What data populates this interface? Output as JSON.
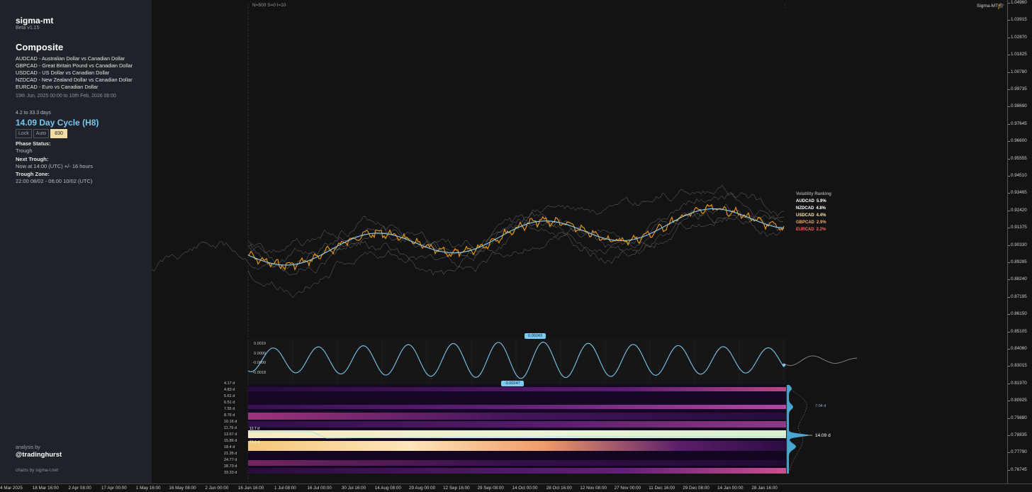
{
  "sidebar": {
    "brand": "sigma-mt",
    "version": "Beta v1.15",
    "title": "Composite",
    "pairs": [
      "AUDCAD - Australian Dollar vs Canadian Dollar",
      "GBPCAD - Great Britain Pound vs Canadian Dollar",
      "USDCAD - US Dollar vs Canadian Dollar",
      "NZDCAD - New Zealand Dollar vs Canadian Dollar",
      "EURCAD - Euro vs Canadian Dollar"
    ],
    "date_range": "19th Jun, 2025 00:00 to 10th Feb, 2026 08:00",
    "cycle_span": "4.2 to 33.3 days",
    "cycle_title": "14.09 Day Cycle (H8)",
    "lock_label": "Lock",
    "auto_label": "Auto",
    "value_label": "830",
    "phase_status_label": "Phase Status:",
    "phase_status_value": "Trough",
    "next_trough_label": "Next Trough:",
    "next_trough_value": "Now at 14:00 (UTC) +/- 16 hours",
    "trough_zone_label": "Trough Zone:",
    "trough_zone_value": "22:00 08/02 - 06:00 10/02 (UTC)",
    "analysis_by": "analysis by",
    "handle": "@tradinghurst",
    "charts_by": "charts by sigma-l.net"
  },
  "header": {
    "params": "N=500  S=0  I=10",
    "brand_right": "Sigma-MT",
    "cap_icon": "graduation-cap-icon"
  },
  "volatility": {
    "title": "Volatility Ranking",
    "items": [
      {
        "pair": "AUDCAD",
        "pct": "5.9%",
        "color": "#ffffff"
      },
      {
        "pair": "NZDCAD",
        "pct": "4.8%",
        "color": "#ffffff"
      },
      {
        "pair": "USDCAD",
        "pct": "4.4%",
        "color": "#ffe7b0"
      },
      {
        "pair": "GBPCAD",
        "pct": "2.9%",
        "color": "#f6a86a"
      },
      {
        "pair": "EURCAD",
        "pct": "2.2%",
        "color": "#f06a5a"
      }
    ]
  },
  "oscillator": {
    "peak_label": "0.00243",
    "trough_label": "-0.00247",
    "ticks": [
      "0.0019",
      "0.0000",
      "-0.0000",
      "-0.0018"
    ]
  },
  "periodogram": {
    "ticks": [
      "4.17 d",
      "4.83 d",
      "5.61 d",
      "6.51 d",
      "7.55 d",
      "8.76 d",
      "10.16 d",
      "11.79 d",
      "13.67 d",
      "15.86 d",
      "18.4 d",
      "21.35 d",
      "24.77 d",
      "28.73 d",
      "33.33 d"
    ],
    "badge_upper": "12.7 d",
    "badge_lower": "15.1 d",
    "peak_main": "14.09 d",
    "peak_secondary": "7.04 d"
  },
  "y_axis": [
    "1.04960",
    "1.03915",
    "1.02870",
    "1.01825",
    "1.00780",
    "0.99735",
    "0.98690",
    "0.97645",
    "0.96600",
    "0.95555",
    "0.94510",
    "0.93465",
    "0.92420",
    "0.91375",
    "0.90330",
    "0.89285",
    "0.88240",
    "0.87195",
    "0.86150",
    "0.85105",
    "0.84060",
    "0.83015",
    "0.81970",
    "0.80925",
    "0.79880",
    "0.78835",
    "0.77790",
    "0.76745"
  ],
  "x_axis": [
    "4 Mar 2025",
    "18 Mar 16:00",
    "2 Apr 08:00",
    "17 Apr 00:00",
    "1 May 16:00",
    "16 May 08:00",
    "2 Jun 00:00",
    "16 Jun 16:00",
    "1 Jul 08:00",
    "16 Jul 00:00",
    "30 Jul 16:00",
    "14 Aug 08:00",
    "29 Aug 00:00",
    "12 Sep 16:00",
    "29 Sep 08:00",
    "14 Oct 00:00",
    "28 Oct 16:00",
    "12 Nov 08:00",
    "27 Nov 00:00",
    "11 Dec 16:00",
    "29 Dec 08:00",
    "14 Jan 00:00",
    "28 Jan 16:00"
  ],
  "colors": {
    "composite": "#f39c12",
    "smooth": "#8ccff2",
    "pairs": "#8a8a8a",
    "sidebar_bg": "#1f2329",
    "accent": "#79c6ef"
  }
}
